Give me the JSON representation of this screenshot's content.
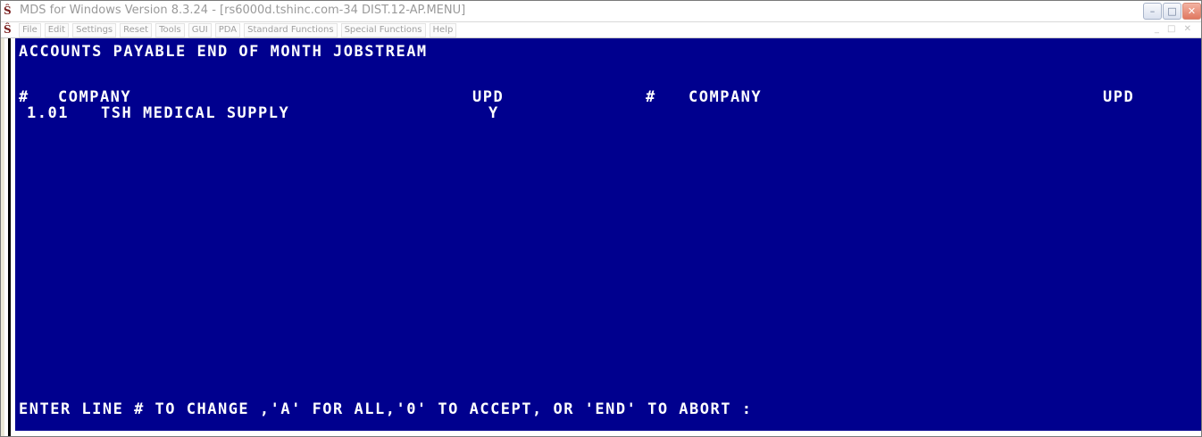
{
  "window": {
    "title": "MDS for Windows Version 8.3.24 - [rs6000d.tshinc.com-34 DIST.12-AP.MENU]",
    "app_icon": "tsh-app-icon",
    "min_glyph": "–",
    "max_glyph": "□",
    "close_glyph": "✕"
  },
  "menu": {
    "items": [
      "File",
      "Edit",
      "Settings",
      "Reset",
      "Tools",
      "GUI",
      "PDA",
      "Standard Functions",
      "Special Functions",
      "Help"
    ],
    "mdi_controls": "_ □ ✕"
  },
  "screen": {
    "heading": "ACCOUNTS PAYABLE END OF MONTH JOBSTREAM",
    "columns": {
      "left_num": "#",
      "left_company": "COMPANY",
      "left_upd": "UPD",
      "right_num": "#",
      "right_company": "COMPANY",
      "right_upd": "UPD"
    },
    "rows": [
      {
        "line": "1.01",
        "company": "TSH MEDICAL SUPPLY",
        "upd": "Y"
      }
    ],
    "prompt": "ENTER LINE # TO CHANGE ,'A' FOR ALL,'0' TO ACCEPT, OR 'END' TO ABORT :"
  },
  "colors": {
    "terminal_bg": "#00008e",
    "terminal_fg": "#ffffff"
  }
}
